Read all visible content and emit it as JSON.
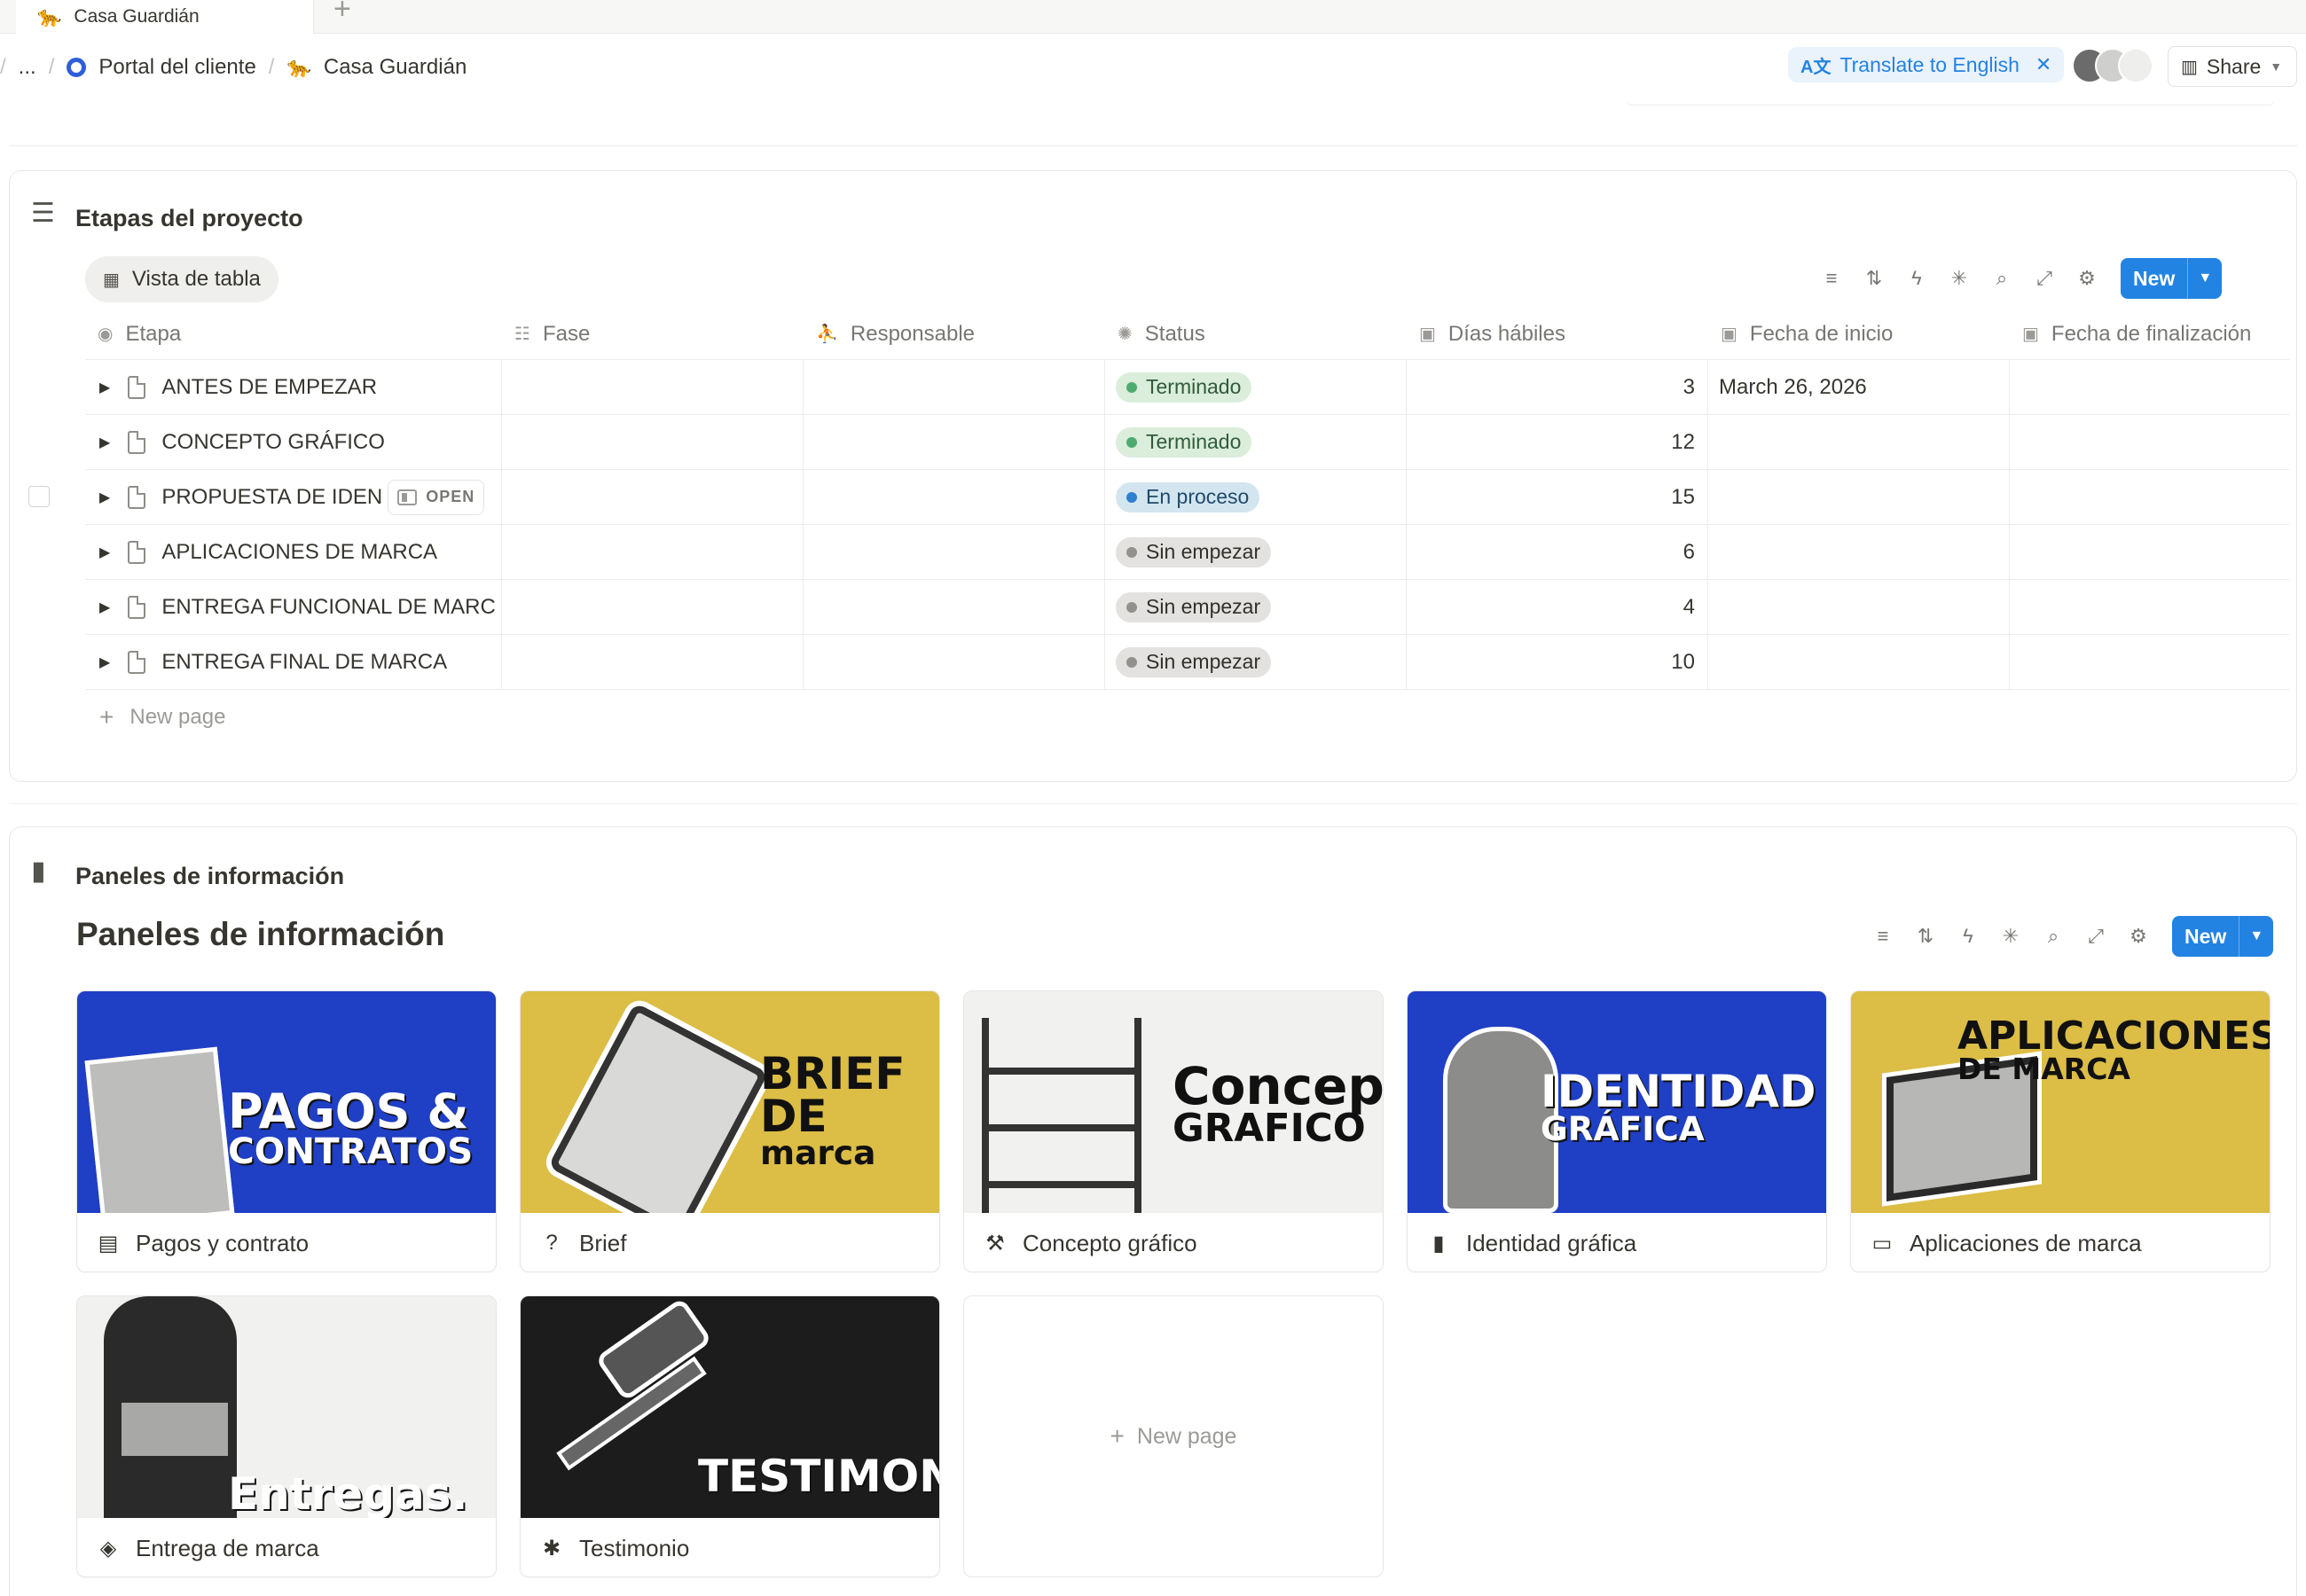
{
  "tab": {
    "title": "Casa Guardián",
    "add": "+"
  },
  "breadcrumb": {
    "ellipsis": "...",
    "portal": "Portal del cliente",
    "page": "Casa Guardián"
  },
  "translate": {
    "label": "Translate to English"
  },
  "share": {
    "label": "Share"
  },
  "stages": {
    "title": "Etapas del proyecto",
    "view": "Vista de tabla",
    "new_label": "New",
    "columns": [
      "Etapa",
      "Fase",
      "Responsable",
      "Status",
      "Días hábiles",
      "Fecha de inicio",
      "Fecha de finalización"
    ],
    "rows": [
      {
        "name": "ANTES DE EMPEZAR",
        "status": "Terminado",
        "days": "3",
        "start": "March 26, 2026"
      },
      {
        "name": "CONCEPTO GRÁFICO",
        "status": "Terminado",
        "days": "12",
        "start": ""
      },
      {
        "name": "PROPUESTA DE IDEN",
        "status": "En proceso",
        "days": "15",
        "start": ""
      },
      {
        "name": "APLICACIONES DE MARCA",
        "status": "Sin empezar",
        "days": "6",
        "start": ""
      },
      {
        "name": "ENTREGA FUNCIONAL DE MARC",
        "status": "Sin empezar",
        "days": "4",
        "start": ""
      },
      {
        "name": "ENTREGA FINAL DE MARCA",
        "status": "Sin empezar",
        "days": "10",
        "start": ""
      }
    ],
    "open_label": "OPEN",
    "new_page": "New page",
    "status_colors": {
      "Terminado": {
        "bg": "#dbeddb",
        "dot": "#4dab6f",
        "fg": "#2f5b3a"
      },
      "En proceso": {
        "bg": "#d3e5ef",
        "dot": "#2f7fd0",
        "fg": "#1f4a6b"
      },
      "Sin empezar": {
        "bg": "#e3e2e0",
        "dot": "#91918e",
        "fg": "#32302c"
      }
    }
  },
  "panels": {
    "section_title": "Paneles de información",
    "gallery_title": "Paneles de información",
    "new_label": "New",
    "new_page": "New page",
    "cards": [
      {
        "label": "Pagos y contrato",
        "cover_line1": "PAGOS &",
        "cover_line2": "CONTRATOS",
        "bg": "#1f3fc4"
      },
      {
        "label": "Brief",
        "cover_line1": "BRIEF DE",
        "cover_line2": "marca",
        "bg": "#dcbd45"
      },
      {
        "label": "Concepto gráfico",
        "cover_line1": "Concepto",
        "cover_line2": "GRAFICO",
        "bg": "#f1f1f0"
      },
      {
        "label": "Identidad gráfica",
        "cover_line1": "IDENTIDAD",
        "cover_line2": "GRÁFICA",
        "bg": "#1f3fc4"
      },
      {
        "label": "Aplicaciones de marca",
        "cover_line1": "APLICACIONES",
        "cover_line2": "DE MARCA",
        "bg": "#dcbd45"
      },
      {
        "label": "Entrega de marca",
        "cover_line1": "Entregas.",
        "cover_line2": "",
        "bg": "#f1f1f0"
      },
      {
        "label": "Testimonio",
        "cover_line1": "TESTIMONIO",
        "cover_line2": "",
        "bg": "#1c1c1c"
      }
    ]
  }
}
